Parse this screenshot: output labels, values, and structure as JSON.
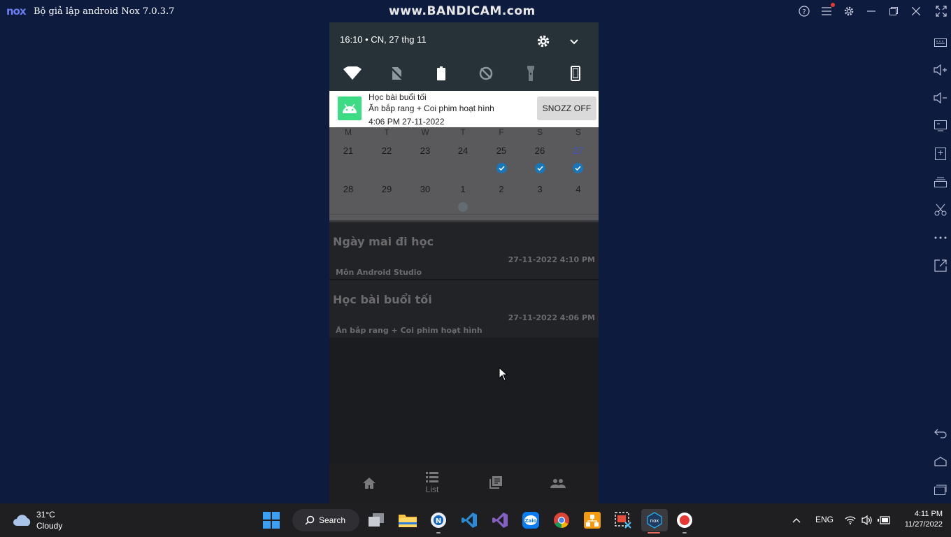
{
  "window": {
    "logo": "nox",
    "title": "Bộ giả lập android Nox 7.0.3.7",
    "watermark": "www.BANDICAM.com"
  },
  "status": {
    "time_date": "16:10 • CN, 27 thg 11"
  },
  "notification": {
    "title": "Học bài buổi tối",
    "body": "Ăn bắp rang + Coi phim hoạt hình",
    "time": "4:06 PM 27-11-2022",
    "action": "SNOZZ OFF"
  },
  "calendar": {
    "weekdays": [
      "M",
      "T",
      "W",
      "T",
      "F",
      "S",
      "S"
    ],
    "week1": [
      "21",
      "22",
      "23",
      "24",
      "25",
      "26",
      "27"
    ],
    "week2": [
      "28",
      "29",
      "30",
      "1",
      "2",
      "3",
      "4"
    ],
    "today": "27",
    "checked_days": [
      "25",
      "26",
      "27"
    ]
  },
  "list": [
    {
      "title": "Ngày mai đi học",
      "date": "27-11-2022 4:10 PM",
      "desc": "Môn Android Studio"
    },
    {
      "title": "Học bài buổi tối",
      "date": "27-11-2022 4:06 PM",
      "desc": "Ăn bắp rang + Coi phim hoạt hình"
    }
  ],
  "bottom_nav": {
    "home_icon": "home-icon",
    "list_label": "List",
    "notes_icon": "library-icon",
    "people_icon": "people-icon"
  },
  "taskbar": {
    "temperature": "31°C",
    "condition": "Cloudy",
    "search_label": "Search",
    "language": "ENG",
    "time": "4:11 PM",
    "date": "11/27/2022"
  },
  "colors": {
    "desktop_bg": "#0d1b3e",
    "shade_bg": "#263238",
    "android_green": "#3ddc84",
    "check_blue": "#1976b8",
    "today_blue": "#3a53c0"
  }
}
